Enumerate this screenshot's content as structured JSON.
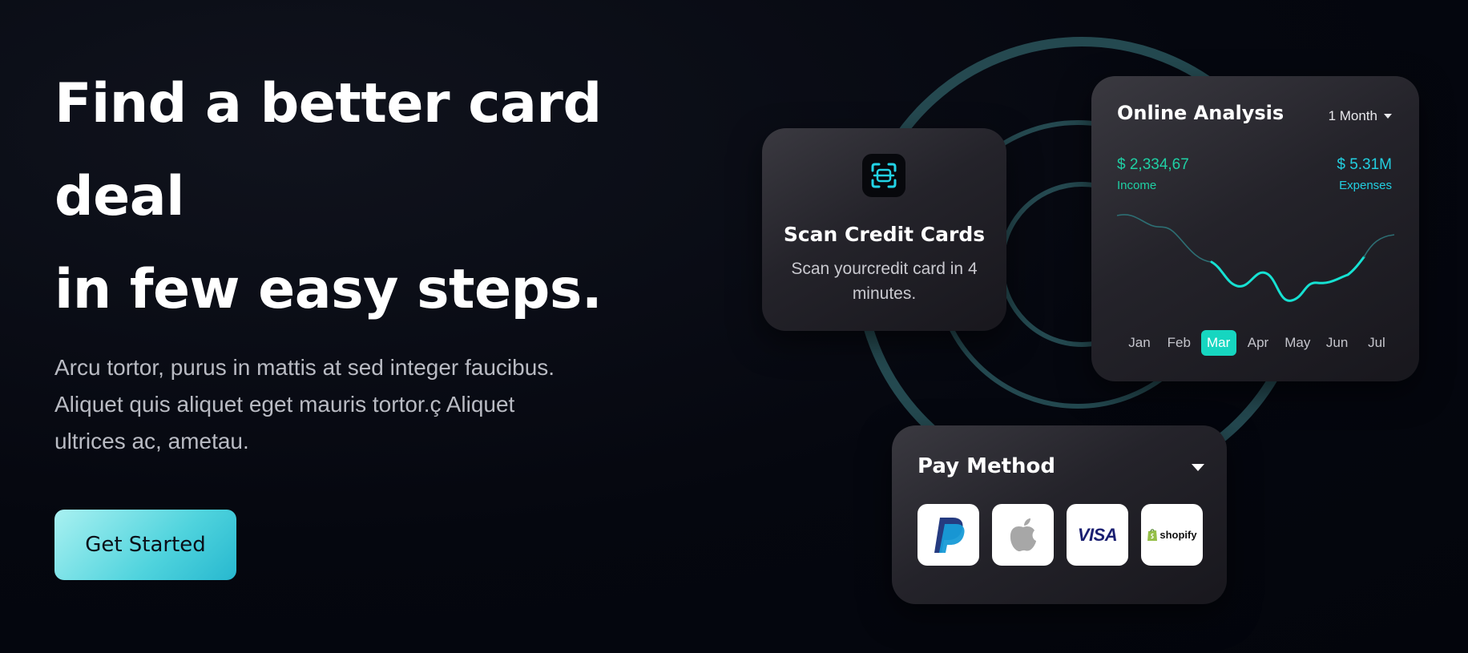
{
  "hero": {
    "title_lines": [
      "Find a better card",
      "deal",
      "in few easy steps."
    ],
    "description_lines": [
      "Arcu tortor, purus in mattis at sed integer faucibus.",
      "Aliquet quis aliquet eget mauris tortor.ç Aliquet",
      "ultrices ac, ametau."
    ],
    "cta_label": "Get Started"
  },
  "scan_card": {
    "icon": "scan-icon",
    "title": "Scan Credit Cards",
    "description": "Scan yourcredit card in 4 minutes."
  },
  "analysis_card": {
    "title": "Online Analysis",
    "period": "1 Month",
    "income": {
      "value": "$ 2,334,67",
      "label": "Income"
    },
    "expenses": {
      "value": "$ 5.31M",
      "label": "Expenses"
    },
    "months": [
      "Jan",
      "Feb",
      "Mar",
      "Apr",
      "May",
      "Jun",
      "Jul"
    ],
    "active_month": "Mar"
  },
  "pay_card": {
    "title": "Pay Method",
    "methods": [
      "paypal-icon",
      "apple-icon",
      "VISA",
      "shopify"
    ]
  },
  "colors": {
    "accent": "#16d6c0",
    "income": "#1fd0a4",
    "expenses": "#22cfe0",
    "ring": "#2a555c"
  }
}
